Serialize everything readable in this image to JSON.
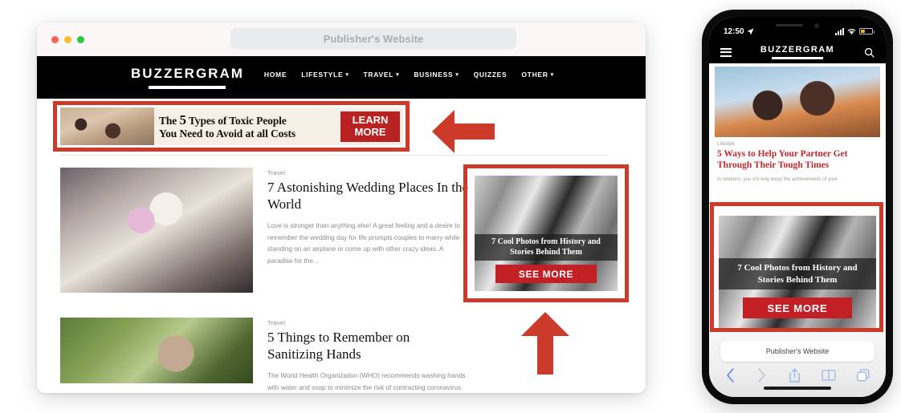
{
  "desktop": {
    "browser": {
      "traffic_lights": [
        "close",
        "minimize",
        "maximize"
      ],
      "address_bar_text": "Publisher's Website"
    },
    "site_header": {
      "brand": "BUZZERGRAM",
      "nav": [
        {
          "label": "HOME",
          "has_dropdown": false
        },
        {
          "label": "LIFESTYLE",
          "has_dropdown": true
        },
        {
          "label": "TRAVEL",
          "has_dropdown": true
        },
        {
          "label": "BUSINESS",
          "has_dropdown": true
        },
        {
          "label": "QUIZZES",
          "has_dropdown": false
        },
        {
          "label": "OTHER",
          "has_dropdown": true
        }
      ]
    },
    "banner_ad": {
      "headline_number": "5",
      "headline_before": "The ",
      "headline_after": " Types of Toxic People",
      "headline_line2": "You Need to Avoid at all Costs",
      "cta_line1": "LEARN",
      "cta_line2": "MORE"
    },
    "articles": [
      {
        "category": "Travel",
        "title": "7 Astonishing Wedding Places In the World",
        "excerpt": "Love is stronger than anything else! A great feeling and a desire to remember the wedding day for life prompts couples to marry while standing on an airplane or come up with other crazy ideas. A paradise for the..."
      },
      {
        "category": "Travel",
        "title": "5 Things to Remember on Sanitizing Hands",
        "excerpt": "The World Health Organization (WHO) recommends washing hands with water and soap to minimize the risk of contracting coronavirus"
      }
    ],
    "sidebar_ad": {
      "headline": "7 Cool Photos from History and Stories Behind Them",
      "cta": "SEE MORE"
    }
  },
  "annotations": {
    "arrow_left": "left-pointing-arrow",
    "arrow_up": "up-pointing-arrow",
    "highlight_color": "#cc3a2a"
  },
  "phone": {
    "status_bar": {
      "time": "12:50",
      "location_icon": "location-arrow-icon"
    },
    "header": {
      "brand": "BUZZERGRAM"
    },
    "article": {
      "category": "Lifestyle",
      "title": "5 Ways to Help Your Partner Get Through Their Tough Times",
      "excerpt": "In relations, you not only enjoy the achievements of your"
    },
    "ad": {
      "headline": "7 Cool Photos from History and Stories Behind Them",
      "cta": "SEE MORE"
    },
    "browser_bar": {
      "url_text": "Publisher's Website"
    }
  }
}
